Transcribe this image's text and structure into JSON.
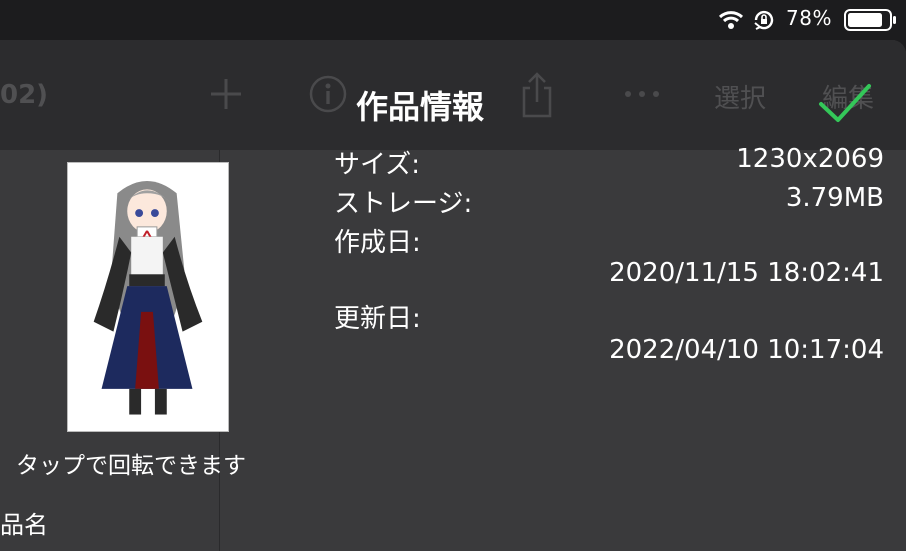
{
  "status_bar": {
    "battery_text": "78%",
    "icons": [
      "wifi-icon",
      "rotation-lock-icon",
      "battery-icon"
    ]
  },
  "background_nav": {
    "title_fragment": "02)",
    "select_label": "選択",
    "edit_label": "編集",
    "icons": [
      "plus-icon",
      "info-icon",
      "share-icon",
      "more-icon"
    ]
  },
  "dialog": {
    "title": "作品情報",
    "confirm_icon": "checkmark-icon",
    "accent_color": "#34c759",
    "thumbnail_hint": "タップで回転できます",
    "name_label": "品名",
    "fields": {
      "size_label": "サイズ:",
      "size_value": "1230x2069",
      "storage_label": "ストレージ:",
      "storage_value": "3.79MB",
      "created_label": "作成日:",
      "created_value": "2020/11/15 18:02:41",
      "updated_label": "更新日:",
      "updated_value": "2022/04/10 10:17:04"
    }
  }
}
